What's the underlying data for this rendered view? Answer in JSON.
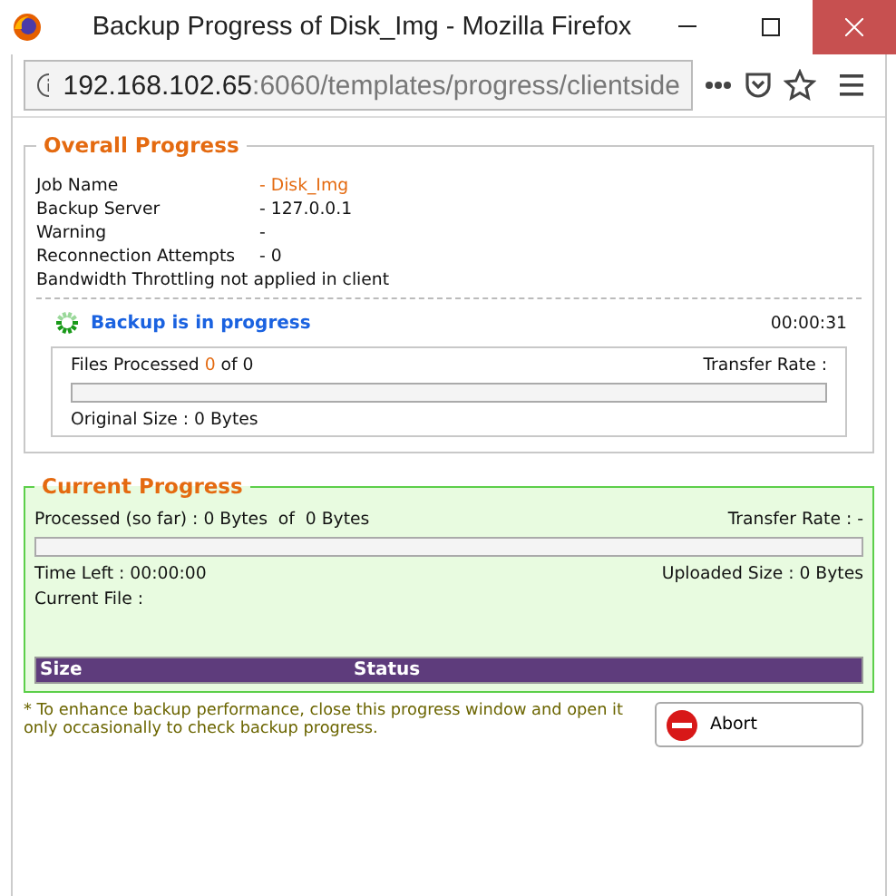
{
  "window": {
    "title": "Backup Progress of Disk_Img - Mozilla Firefox"
  },
  "address_bar": {
    "host": "192.168.102.65",
    "path": ":6060/templates/progress/clientside"
  },
  "overall": {
    "title": "Overall Progress",
    "fields": [
      {
        "label": "Job Name",
        "value": "- Disk_Img",
        "highlight": true
      },
      {
        "label": "Backup Server",
        "value": "- 127.0.0.1",
        "highlight": false
      },
      {
        "label": "Warning",
        "value": "-",
        "highlight": false
      },
      {
        "label": "Reconnection Attempts",
        "value": "- 0",
        "highlight": false
      }
    ],
    "note": "Bandwidth Throttling not applied in client",
    "status": "Backup is in progress",
    "elapsed": "00:00:31",
    "files_label": "Files Processed",
    "files_done": "0",
    "files_of": "of 0",
    "transfer_rate": "Transfer Rate :",
    "level": 0,
    "original_size": "Original Size : 0 Bytes"
  },
  "current": {
    "title": "Current Progress",
    "processed": "Processed (so far) : 0 Bytes  of  0 Bytes",
    "transfer_rate": "Transfer Rate : -",
    "level": 0,
    "time_left": "Time Left : 00:00:00",
    "uploaded": "Uploaded Size : 0 Bytes",
    "current_file": "Current File :",
    "columns": [
      "Size",
      "Status"
    ]
  },
  "hint": "* To enhance backup performance, close this progress window and open it only occasionally to check backup progress.",
  "buttons": [
    "Abort"
  ]
}
